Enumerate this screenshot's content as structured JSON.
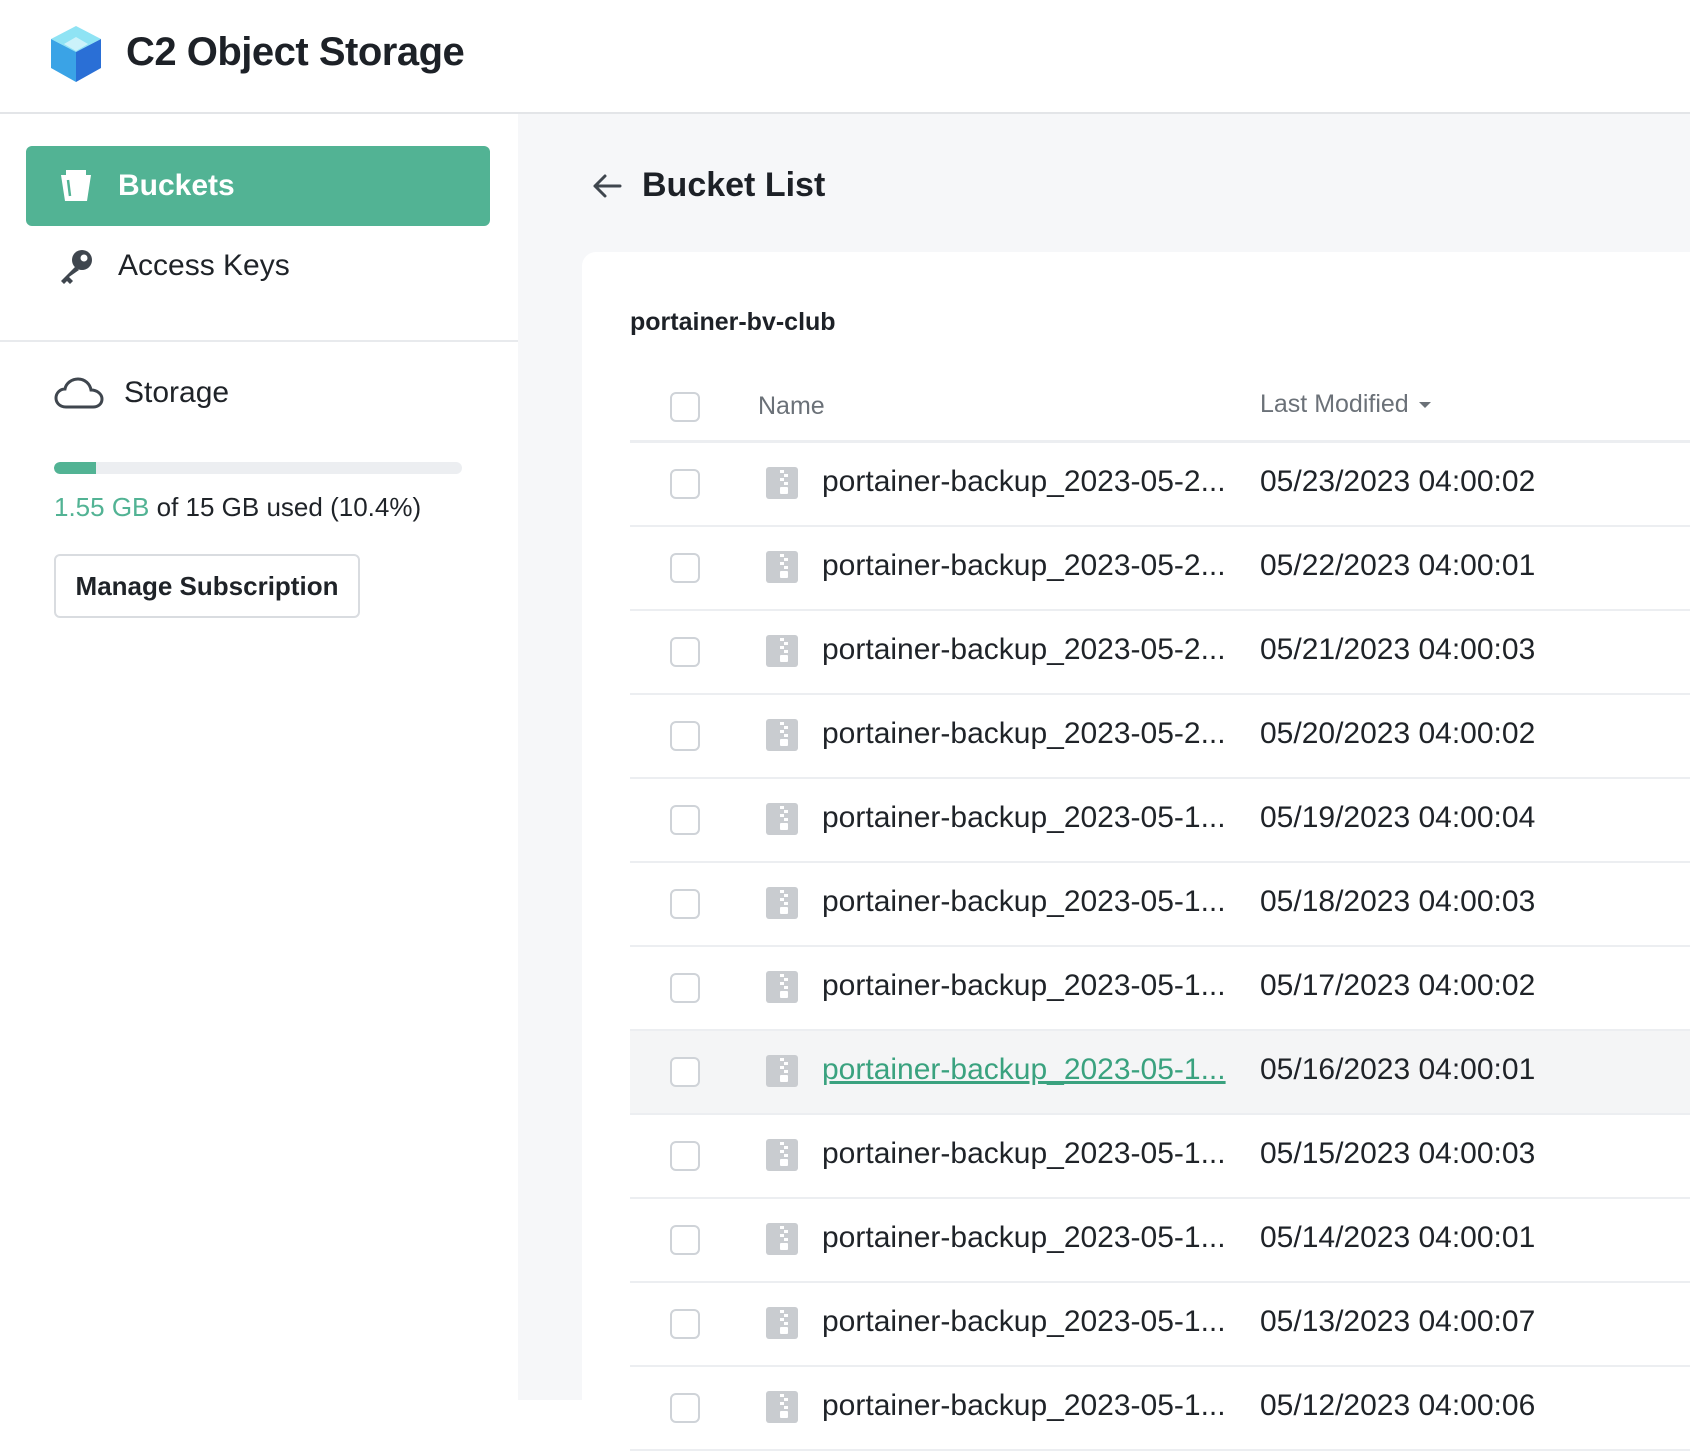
{
  "app": {
    "title": "C2 Object Storage"
  },
  "sidebar": {
    "items": [
      {
        "label": "Buckets",
        "icon": "bucket-icon",
        "active": true
      },
      {
        "label": "Access Keys",
        "icon": "key-icon",
        "active": false
      }
    ],
    "storage": {
      "label": "Storage",
      "icon": "cloud-icon",
      "used": "1.55 GB",
      "rest": " of 15 GB used (10.4%)",
      "percent": 10.4,
      "manage_label": "Manage Subscription"
    }
  },
  "main": {
    "title": "Bucket List",
    "bucket_name": "portainer-bv-club",
    "columns": {
      "name": "Name",
      "modified": "Last Modified"
    },
    "rows": [
      {
        "name": "portainer-backup_2023-05-2...",
        "modified": "05/23/2023 04:00:02"
      },
      {
        "name": "portainer-backup_2023-05-2...",
        "modified": "05/22/2023 04:00:01"
      },
      {
        "name": "portainer-backup_2023-05-2...",
        "modified": "05/21/2023 04:00:03"
      },
      {
        "name": "portainer-backup_2023-05-2...",
        "modified": "05/20/2023 04:00:02"
      },
      {
        "name": "portainer-backup_2023-05-1...",
        "modified": "05/19/2023 04:00:04"
      },
      {
        "name": "portainer-backup_2023-05-1...",
        "modified": "05/18/2023 04:00:03"
      },
      {
        "name": "portainer-backup_2023-05-1...",
        "modified": "05/17/2023 04:00:02"
      },
      {
        "name": "portainer-backup_2023-05-1...",
        "modified": "05/16/2023 04:00:01"
      },
      {
        "name": "portainer-backup_2023-05-1...",
        "modified": "05/15/2023 04:00:03"
      },
      {
        "name": "portainer-backup_2023-05-1...",
        "modified": "05/14/2023 04:00:01"
      },
      {
        "name": "portainer-backup_2023-05-1...",
        "modified": "05/13/2023 04:00:07"
      },
      {
        "name": "portainer-backup_2023-05-1...",
        "modified": "05/12/2023 04:00:06"
      }
    ],
    "hovered_row": 7
  },
  "colors": {
    "accent": "#52b394",
    "link": "#3aa27f",
    "text": "#1f2328",
    "muted": "#6b7178"
  }
}
